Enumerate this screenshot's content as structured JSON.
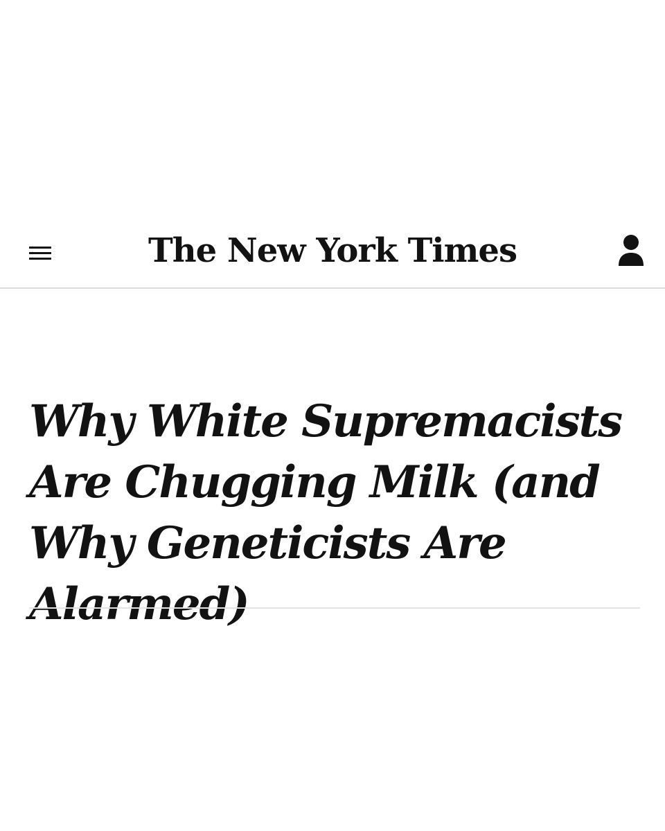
{
  "header": {
    "menu_icon": "hamburger-menu-icon",
    "logo_text": "The New York Times",
    "account_icon": "user-account-icon"
  },
  "article": {
    "headline": "Why White Supremacists Are Chugging Milk (and Why Geneticists Are Alarmed)"
  },
  "colors": {
    "text": "#121212",
    "divider": "#dcdcdc",
    "background": "#ffffff"
  }
}
